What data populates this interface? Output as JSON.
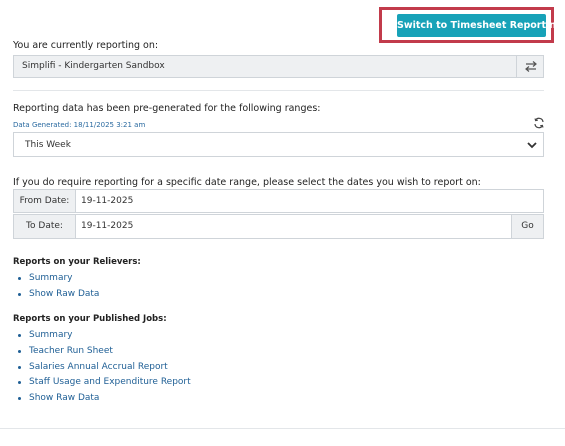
{
  "header": {
    "switch_button": "Switch to Timesheet Reporting"
  },
  "reporting_on": {
    "label": "You are currently reporting on:",
    "value": "Simplifi - Kindergarten Sandbox",
    "switch_icon": "swap-arrows-icon"
  },
  "pregenerated": {
    "label": "Reporting data has been pre-generated for the following ranges:",
    "generated_text": "Data Generated: 18/11/2025 3:21 am",
    "refresh_icon": "refresh-icon",
    "selected_range": "This Week",
    "dropdown_icon": "chevron-down-icon"
  },
  "custom_range": {
    "label": "If you do require reporting for a specific date range, please select the dates you wish to report on:",
    "from_label": "From Date:",
    "from_value": "19-11-2025",
    "to_label": "To Date:",
    "to_value": "19-11-2025",
    "go_label": "Go"
  },
  "relievers": {
    "title": "Reports on your Relievers:",
    "links": [
      "Summary",
      "Show Raw Data"
    ]
  },
  "published_jobs": {
    "title": "Reports on your Published Jobs:",
    "links": [
      "Summary",
      "Teacher Run Sheet",
      "Salaries Annual Accrual Report",
      "Staff Usage and Expenditure Report",
      "Show Raw Data"
    ]
  },
  "colors": {
    "accent": "#17a2b8",
    "highlight_border": "#c23b4b",
    "link": "#1f5f95"
  }
}
